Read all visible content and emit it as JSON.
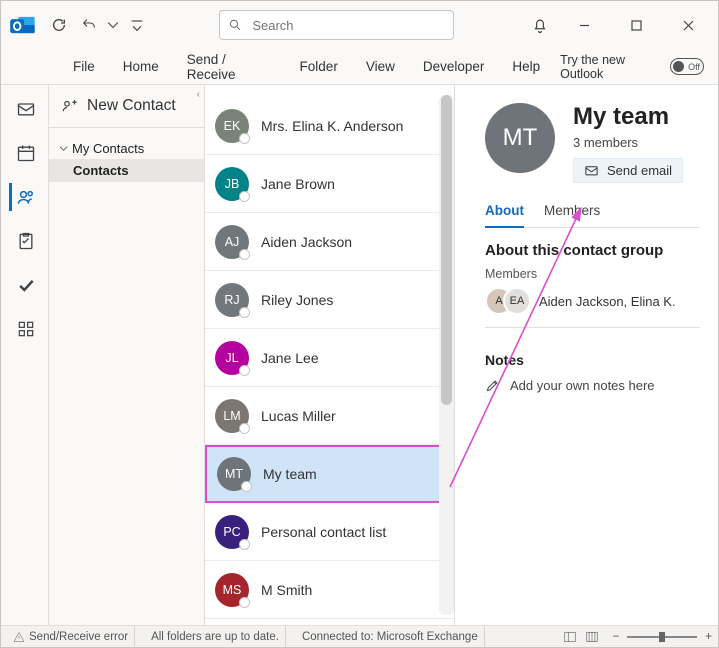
{
  "search": {
    "placeholder": "Search"
  },
  "menu": {
    "items": [
      "File",
      "Home",
      "Send / Receive",
      "Folder",
      "View",
      "Developer",
      "Help"
    ],
    "try_new": "Try the new Outlook",
    "toggle_label": "Off"
  },
  "sub_panel": {
    "new_contact": "New Contact",
    "tree_parent": "My Contacts",
    "tree_child": "Contacts"
  },
  "contacts": [
    {
      "initials": "EK",
      "name": "Mrs. Elina K. Anderson",
      "color": "#7a837a"
    },
    {
      "initials": "JB",
      "name": "Jane Brown",
      "color": "#038387"
    },
    {
      "initials": "AJ",
      "name": "Aiden Jackson",
      "color": "#6f7779"
    },
    {
      "initials": "RJ",
      "name": "Riley Jones",
      "color": "#71777d"
    },
    {
      "initials": "JL",
      "name": "Jane Lee",
      "color": "#b4009e"
    },
    {
      "initials": "LM",
      "name": "Lucas Miller",
      "color": "#7b7672"
    },
    {
      "initials": "MT",
      "name": "My team",
      "color": "#6e7479",
      "selected": true
    },
    {
      "initials": "PC",
      "name": "Personal contact list",
      "color": "#39207c"
    },
    {
      "initials": "MS",
      "name": "M Smith",
      "color": "#a4262c"
    }
  ],
  "detail": {
    "avatar_initials": "MT",
    "title": "My team",
    "subtitle": "3 members",
    "send_email": "Send email",
    "tabs": [
      "About",
      "Members"
    ],
    "section_title": "About this contact group",
    "members_label": "Members",
    "member_avatars": [
      "A",
      "EA"
    ],
    "member_names": "Aiden Jackson, Elina K.",
    "notes_title": "Notes",
    "notes_placeholder": "Add your own notes here"
  },
  "statusbar": {
    "error": "Send/Receive error",
    "folders": "All folders are up to date.",
    "connection": "Connected to: Microsoft Exchange"
  }
}
